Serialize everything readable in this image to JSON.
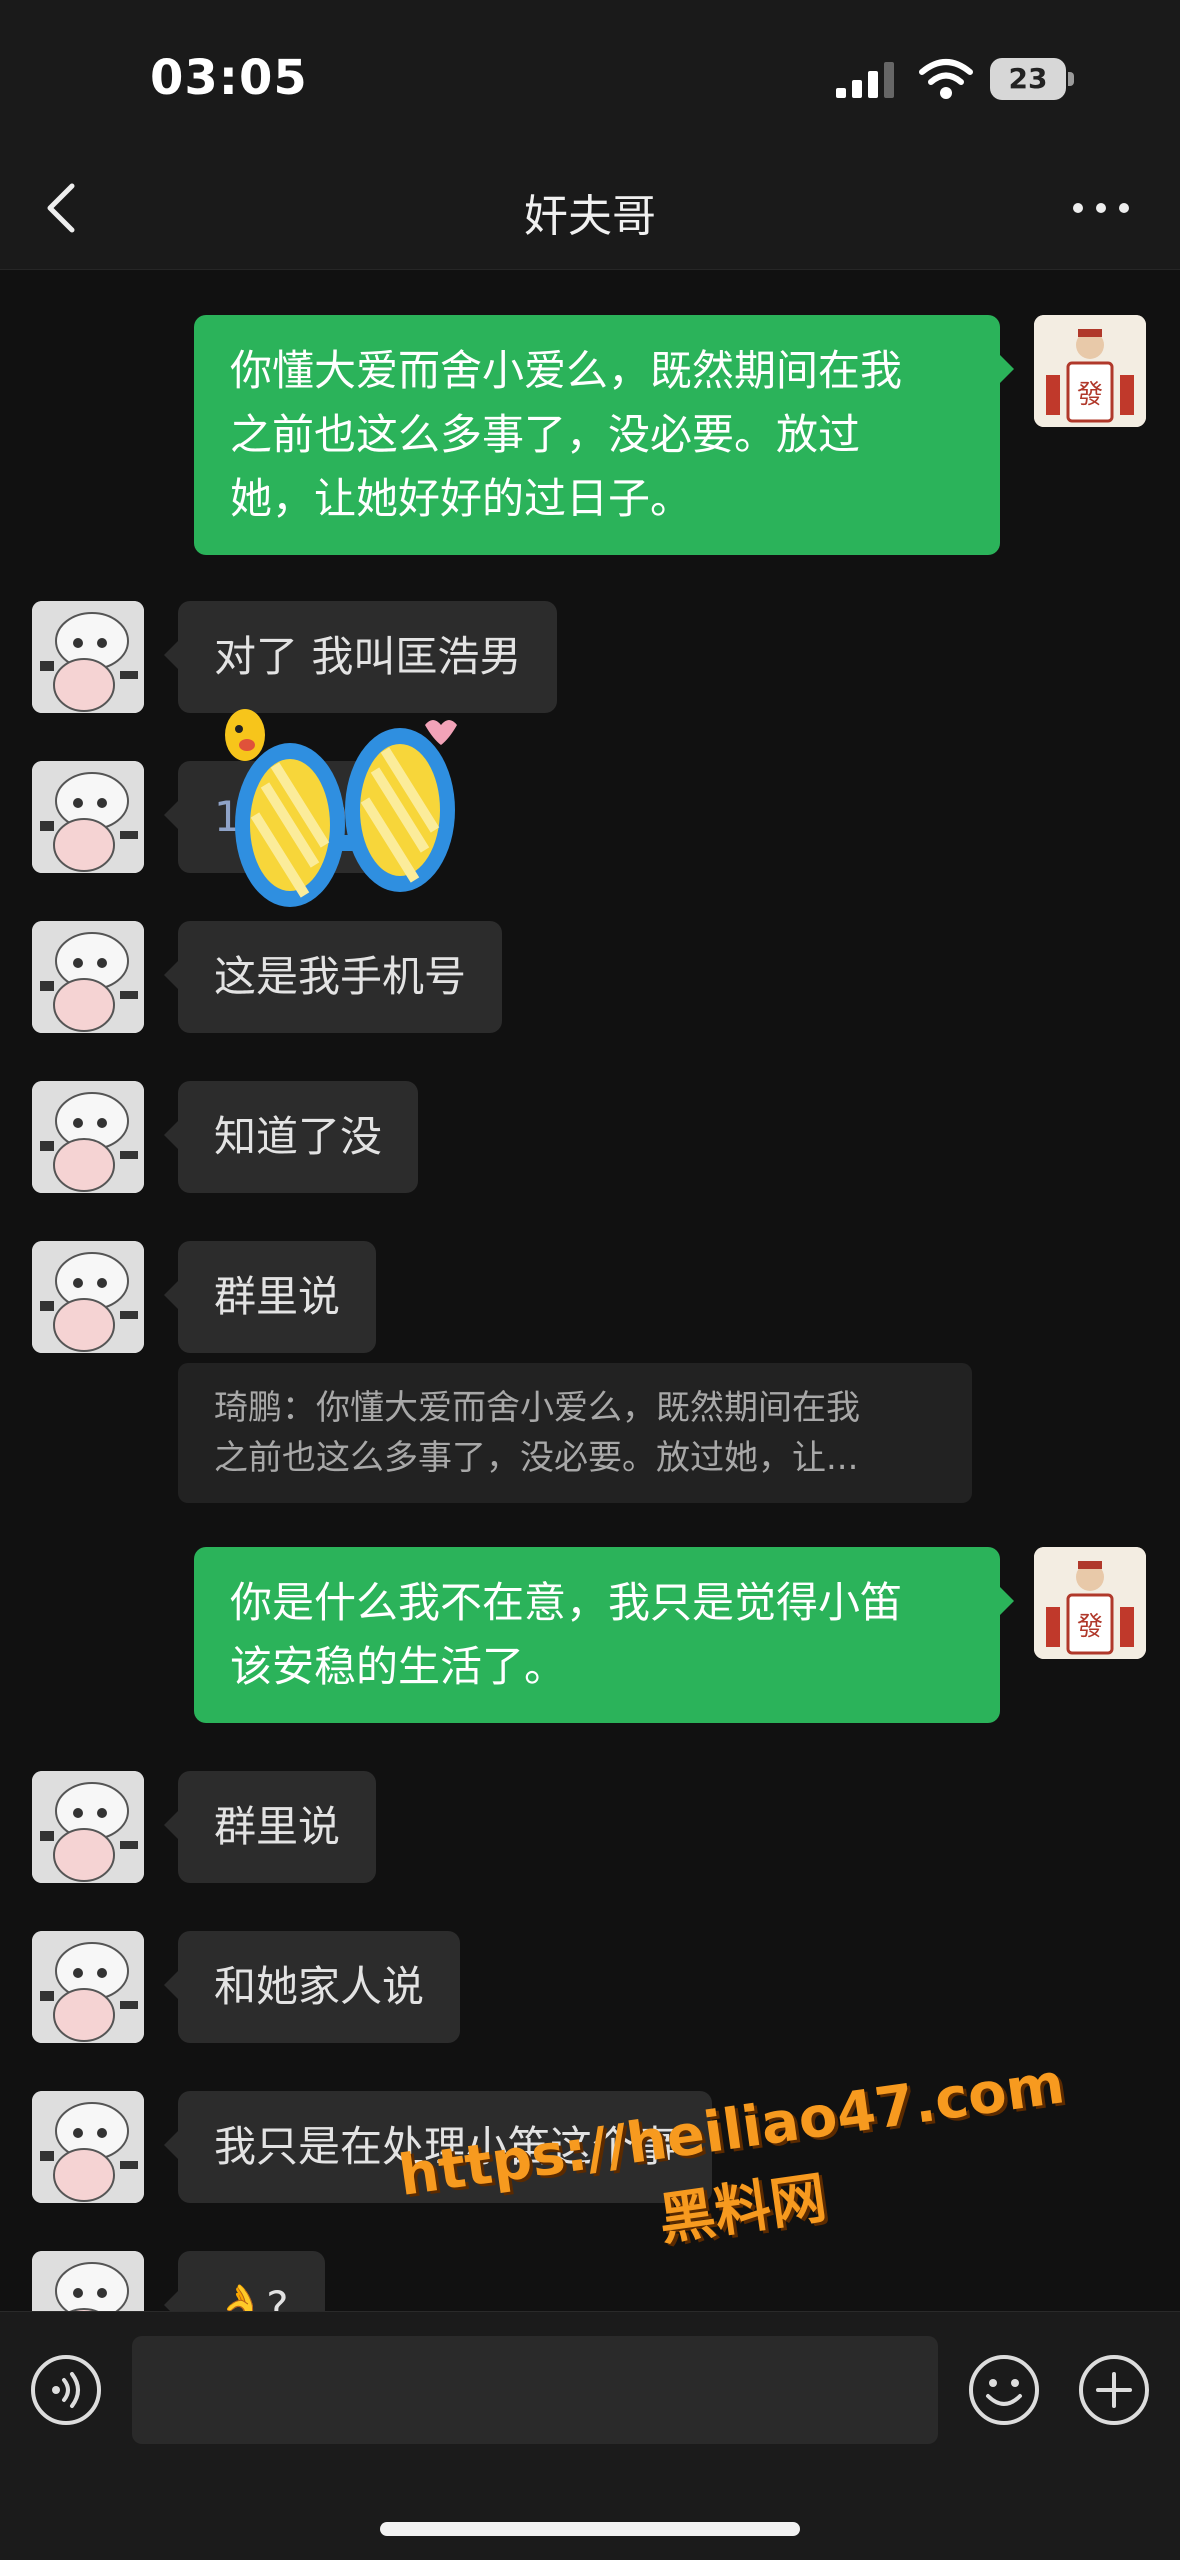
{
  "status_bar": {
    "time": "03:05",
    "battery": "23"
  },
  "nav": {
    "title": "奸夫哥"
  },
  "messages": [
    {
      "side": "out",
      "lines": [
        "你懂大爱而舍小爱么，既然期间在我",
        "之前也这么多事了，没必要。放过",
        "她，让她好好的过日子。"
      ]
    },
    {
      "side": "in",
      "text": "对了 我叫匡浩男"
    },
    {
      "side": "in",
      "text": "1  5  604"
    },
    {
      "side": "in",
      "text": "这是我手机号"
    },
    {
      "side": "in",
      "text": "知道了没"
    },
    {
      "side": "in",
      "text": "群里说"
    },
    {
      "side": "quote",
      "lines": [
        "琦鹏：你懂大爱而舍小爱么，既然期间在我",
        "之前也这么多事了，没必要。放过她，让..."
      ]
    },
    {
      "side": "out",
      "lines": [
        "你是什么我不在意，我只是觉得小笛",
        "该安稳的生活了。"
      ]
    },
    {
      "side": "in",
      "text": "群里说"
    },
    {
      "side": "in",
      "text": "和她家人说"
    },
    {
      "side": "in",
      "text": "我只是在处理小笛这个事"
    },
    {
      "side": "in",
      "text": "👌?"
    }
  ],
  "watermark": {
    "line1": "https://heiliao47.com",
    "line2": "黑料网"
  },
  "input": {
    "placeholder": ""
  },
  "icons": {
    "back": "chevron-left-icon",
    "more": "more-dots-icon",
    "voice": "voice-icon",
    "emoji": "emoji-icon",
    "plus": "plus-icon"
  },
  "colors": {
    "outgoing_bubble": "#2bb35a",
    "incoming_bubble": "#2c2c2c",
    "background": "#111111",
    "watermark": "#f79a1f"
  }
}
